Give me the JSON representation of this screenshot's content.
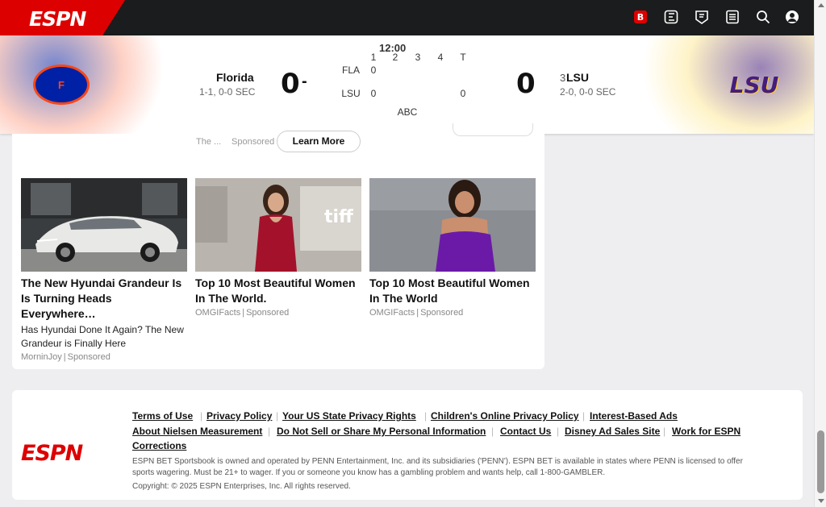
{
  "nav": {
    "logo_text": "ESPN",
    "icons": [
      "espn-bet-icon",
      "fantasy-icon",
      "watch-icon",
      "scores-icon",
      "search-icon",
      "profile-icon"
    ]
  },
  "game": {
    "away": {
      "name": "Florida",
      "record": "1-1, 0-0 SEC",
      "score": "0",
      "logo_label": "F",
      "color": "#0021a5",
      "accent": "#fa4616"
    },
    "home": {
      "rank": "3",
      "name": "LSU",
      "record": "2-0, 0-0 SEC",
      "score": "0",
      "logo_label": "LSU",
      "color": "#461d7c",
      "accent": "#fdd023"
    },
    "separator": "-",
    "status": "12:00",
    "network": "ABC",
    "linescore": {
      "headers": [
        "1",
        "2",
        "3",
        "4",
        "T"
      ],
      "rows": [
        {
          "team": "FLA",
          "values": [
            "0",
            "",
            "",
            "",
            ""
          ]
        },
        {
          "team": "LSU",
          "values": [
            "0",
            "",
            "",
            "",
            "0"
          ]
        }
      ]
    }
  },
  "promo": {
    "text": "The ...",
    "sponsored": "Sponsored",
    "cta": "Learn More"
  },
  "ads": [
    {
      "title": "The New Hyundai Grandeur Is Is Turning Heads Everywhere…",
      "description": "Has Hyundai Done It Again? The New Grandeur is Finally Here",
      "source": "MorninJoy",
      "sponsored": "Sponsored"
    },
    {
      "title": "Top 10 Most Beautiful Women In The World.",
      "description": "",
      "source": "OMGIFacts",
      "sponsored": "Sponsored"
    },
    {
      "title": "Top 10 Most Beautiful Women In The World",
      "description": "",
      "source": "OMGIFacts",
      "sponsored": "Sponsored"
    }
  ],
  "footer": {
    "logo_text": "ESPN",
    "links": {
      "terms": "Terms of Use",
      "privacy": "Privacy Policy",
      "us_state": "Your US State Privacy Rights",
      "children": "Children's Online Privacy Policy",
      "interest": "Interest-Based Ads",
      "nielsen": "About Nielsen Measurement",
      "do_not_sell": "Do Not Sell or Share My Personal Information",
      "contact": "Contact Us",
      "disney": "Disney Ad Sales Site",
      "work": "Work for ESPN",
      "corrections": "Corrections"
    },
    "legal": "ESPN BET Sportsbook is owned and operated by PENN Entertainment, Inc. and its subsidiaries ('PENN'). ESPN BET is available in states where PENN is licensed to offer sports wagering. Must be 21+ to wager. If you or someone you know has a gambling problem and wants help, call 1-800-GAMBLER.",
    "copyright": "Copyright: © 2025 ESPN Enterprises, Inc. All rights reserved."
  }
}
